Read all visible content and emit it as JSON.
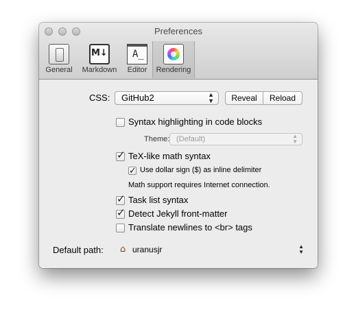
{
  "window": {
    "title": "Preferences"
  },
  "toolbar": {
    "items": [
      {
        "label": "General",
        "icon": "switch-icon"
      },
      {
        "label": "Markdown",
        "icon": "markdown-icon"
      },
      {
        "label": "Editor",
        "icon": "editor-icon"
      },
      {
        "label": "Rendering",
        "icon": "color-wheel-icon",
        "selected": true
      }
    ]
  },
  "css": {
    "label": "CSS:",
    "value": "GitHub2",
    "reveal_label": "Reveal",
    "reload_label": "Reload"
  },
  "options": {
    "syntax_highlighting": {
      "label": "Syntax highlighting in code blocks",
      "checked": false
    },
    "theme": {
      "label": "Theme:",
      "value": "(Default)",
      "enabled": false
    },
    "tex_math": {
      "label": "TeX-like math syntax",
      "checked": true
    },
    "dollar_sign": {
      "label": "Use dollar sign ($) as inline delimiter",
      "checked": true
    },
    "math_note": "Math support requires Internet connection.",
    "task_list": {
      "label": "Task list syntax",
      "checked": true
    },
    "jekyll": {
      "label": "Detect Jekyll front-matter",
      "checked": true
    },
    "newlines": {
      "label": "Translate newlines to <br> tags",
      "checked": false
    }
  },
  "default_path": {
    "label": "Default path:",
    "value": "uranusjr"
  },
  "colors": {
    "accent": "#3b6fd6",
    "window_bg": "#ececec"
  }
}
